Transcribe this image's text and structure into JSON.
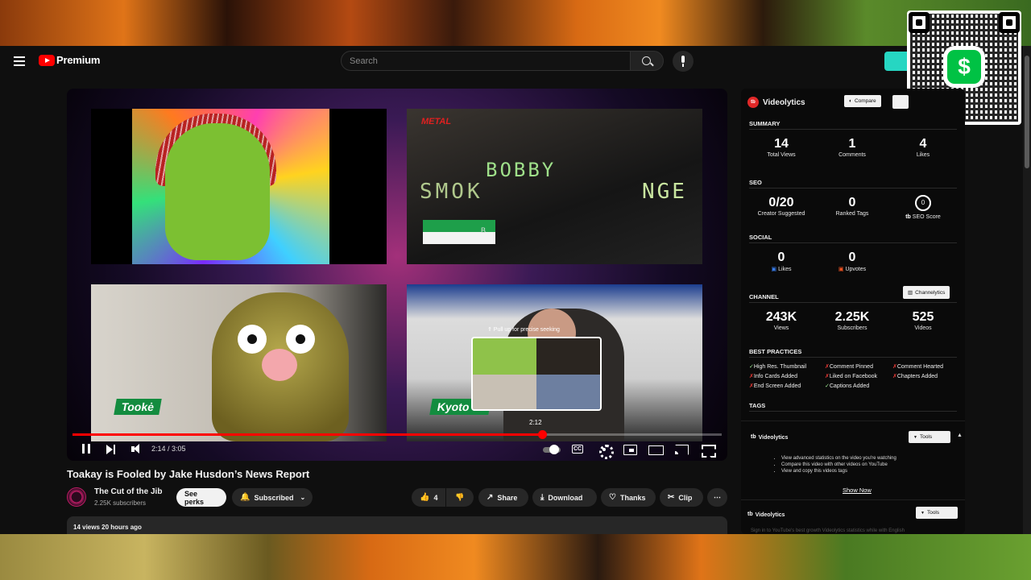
{
  "header": {
    "logo_text": "Premium",
    "search_placeholder": "Search"
  },
  "player": {
    "tiles": {
      "t2_neon_left": "SMOK",
      "t2_neon_mid": "BOBBY",
      "t2_neon_right": "NGE",
      "t2_sign": "METAL",
      "t2_tag": "B",
      "t3_name": "Tookė",
      "t4_name": "Kyoto W"
    },
    "pull_hint": "⇑ Pull up for precise seeking",
    "hover_time": "2:12",
    "current_time": "2:14",
    "duration": "3:05",
    "time_display": "2:14 / 3:05",
    "progress_fraction": 0.723
  },
  "video": {
    "title": "Toakay is Fooled by Jake Husdon’s News Report",
    "channel_name": "The Cut of the Jib",
    "channel_subs": "2.25K subscribers",
    "see_perks_label": "See perks",
    "subscribed_label": "Subscribed",
    "like_count": "4",
    "share_label": "Share",
    "download_label": "Download",
    "thanks_label": "Thanks",
    "clip_label": "Clip",
    "views_line": "14 views  20 hours ago"
  },
  "sidebar": {
    "brand": "Videolytics",
    "compare_label": "Compare",
    "summary_title": "SUMMARY",
    "summary": [
      {
        "value": "14",
        "label": "Total Views"
      },
      {
        "value": "1",
        "label": "Comments"
      },
      {
        "value": "4",
        "label": "Likes"
      }
    ],
    "seo_title": "SEO",
    "seo": [
      {
        "value": "0/20",
        "label": "Creator Suggested"
      },
      {
        "value": "0",
        "label": "Ranked Tags"
      },
      {
        "value": "0",
        "label": "SEO Score"
      }
    ],
    "social_title": "SOCIAL",
    "social": [
      {
        "value": "0",
        "label": "Likes"
      },
      {
        "value": "0",
        "label": "Upvotes"
      }
    ],
    "channel_title": "CHANNEL",
    "channelytics_label": "Channelytics",
    "channel": [
      {
        "value": "243K",
        "label": "Views"
      },
      {
        "value": "2.25K",
        "label": "Subscribers"
      },
      {
        "value": "525",
        "label": "Videos"
      }
    ],
    "best_practices_title": "BEST PRACTICES",
    "best_practices": [
      {
        "mark": "✓",
        "label": "High Res. Thumbnail",
        "status": "ok"
      },
      {
        "mark": "✗",
        "label": "Comment Pinned",
        "status": "bad"
      },
      {
        "mark": "✗",
        "label": "Comment Hearted",
        "status": "bad"
      },
      {
        "mark": "✗",
        "label": "Info Cards Added",
        "status": "bad"
      },
      {
        "mark": "✗",
        "label": "Liked on Facebook",
        "status": "bad"
      },
      {
        "mark": "✗",
        "label": "Chapters Added",
        "status": "bad"
      },
      {
        "mark": "✗",
        "label": "End Screen Added",
        "status": "bad"
      },
      {
        "mark": "✓",
        "label": "Captions Added",
        "status": "ok"
      }
    ],
    "tags_title": "TAGS",
    "tools_brand": "Videolytics",
    "tools_label": "Tools",
    "tools_items": [
      "View advanced statistics on the video you're watching",
      "Compare this video with other videos on YouTube",
      "View and copy this videos tags"
    ],
    "show_now_label": "Show Now",
    "tools_brand_2": "Videolytics",
    "tools_label_2": "Tools",
    "fade_text": "Sign in to YouTube's best growth Videolytics statistics while with English"
  },
  "overlay": {
    "cash_symbol": "$"
  },
  "colors": {
    "accent_red": "#ff0000",
    "cashapp_green": "#00c244",
    "extension_teal": "#26d6c2"
  },
  "icons": [
    "menu-icon",
    "youtube-logo-icon",
    "search-icon",
    "mic-icon",
    "pause-icon",
    "next-icon",
    "volume-icon",
    "cc-icon",
    "gear-icon",
    "miniplayer-icon",
    "theater-icon",
    "cast-icon",
    "fullscreen-icon",
    "bell-icon",
    "thumbs-up-icon",
    "thumbs-down-icon",
    "share-icon",
    "download-icon",
    "thanks-icon",
    "clip-icon",
    "more-icon"
  ]
}
